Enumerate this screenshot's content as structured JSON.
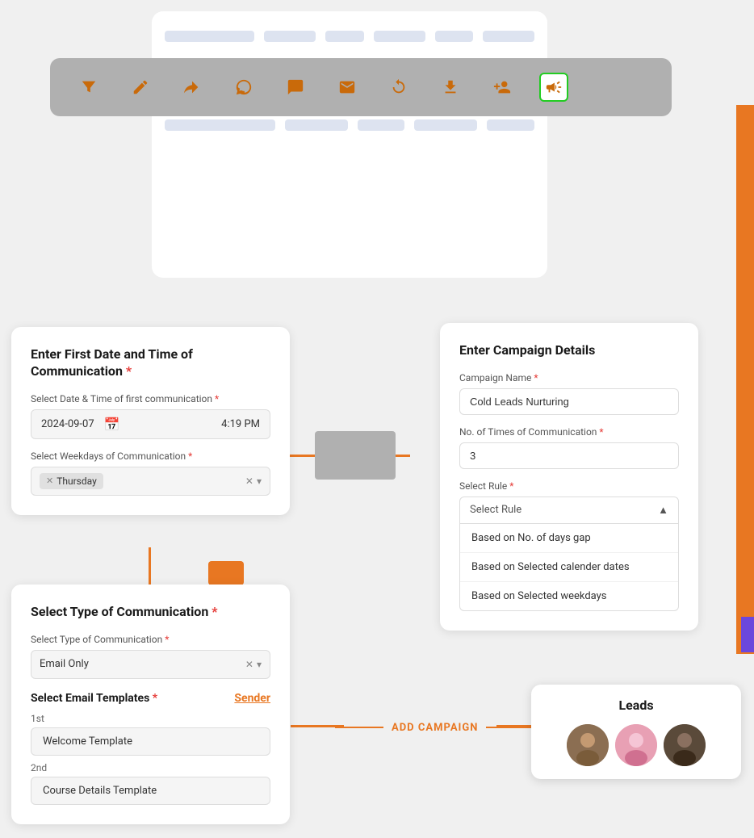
{
  "toolbar": {
    "icons": [
      {
        "name": "filter-icon",
        "symbol": "⧩",
        "active": false
      },
      {
        "name": "edit-icon",
        "symbol": "✎",
        "active": false
      },
      {
        "name": "forward-icon",
        "symbol": "↪",
        "active": false
      },
      {
        "name": "whatsapp-icon",
        "symbol": "📱",
        "active": false
      },
      {
        "name": "chat-icon",
        "symbol": "💬",
        "active": false
      },
      {
        "name": "email-icon",
        "symbol": "✉",
        "active": false
      },
      {
        "name": "refresh-icon",
        "symbol": "↻",
        "active": false
      },
      {
        "name": "download-icon",
        "symbol": "⬇",
        "active": false
      },
      {
        "name": "person-add-icon",
        "symbol": "👤",
        "active": false
      },
      {
        "name": "campaign-icon",
        "symbol": "📣",
        "active": true
      }
    ]
  },
  "date_card": {
    "title": "Enter First Date and Time of",
    "title2": "Communication",
    "field_label": "Select Date & Time of first communication",
    "date_value": "2024-09-07",
    "time_value": "4:19 PM",
    "weekdays_label": "Select Weekdays of Communication",
    "selected_weekday": "Thursday"
  },
  "campaign_card": {
    "title": "Enter Campaign Details",
    "campaign_name_label": "Campaign Name",
    "campaign_name_value": "Cold Leads Nurturing",
    "no_of_times_label": "No. of Times of Communication",
    "no_of_times_value": "3",
    "select_rule_label": "Select Rule",
    "select_rule_placeholder": "Select Rule",
    "dropdown_items": [
      "Based on No. of days gap",
      "Based on Selected calender dates",
      "Based on Selected weekdays"
    ]
  },
  "comm_card": {
    "title": "Select Type of Communication",
    "type_label": "Select Type of Communication",
    "type_value": "Email Only",
    "templates_title": "Select Email Templates",
    "sender_link": "Sender",
    "template_1_idx": "1st",
    "template_1_value": "Welcome Template",
    "template_2_idx": "2nd",
    "template_2_value": "Course Details Template"
  },
  "add_campaign": {
    "label": "ADD CAMPAIGN"
  },
  "leads_card": {
    "title": "Leads",
    "avatars": [
      {
        "name": "avatar-1",
        "initials": "👨"
      },
      {
        "name": "avatar-2",
        "initials": "👩"
      },
      {
        "name": "avatar-3",
        "initials": "👨"
      }
    ]
  }
}
